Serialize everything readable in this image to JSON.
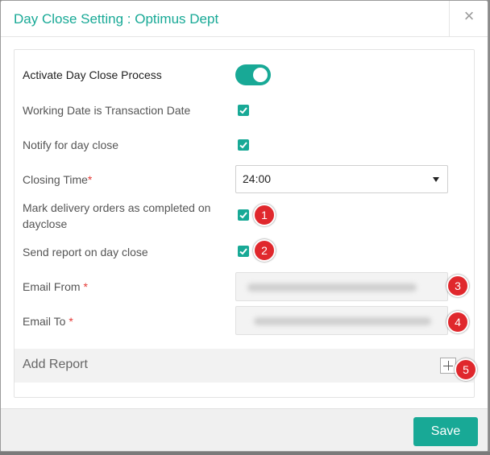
{
  "modal": {
    "title": "Day Close Setting : Optimus Dept",
    "close_glyph": "×"
  },
  "settings": {
    "activate_label": "Activate Day Close Process",
    "activate_on": true,
    "working_date_label": "Working Date is Transaction Date",
    "working_date_checked": true,
    "notify_label": "Notify for day close",
    "notify_checked": true,
    "closing_time_label": "Closing Time",
    "closing_time_value": "24:00",
    "mark_delivery_label_line1": "Mark delivery orders as completed on",
    "mark_delivery_label_line2": "dayclose",
    "mark_delivery_checked": true,
    "send_report_label": "Send report on day close",
    "send_report_checked": true,
    "email_from_label": "Email From",
    "email_to_label": "Email To",
    "required_mark": "*"
  },
  "badges": [
    "1",
    "2",
    "3",
    "4",
    "5"
  ],
  "add_report": {
    "label": "Add Report"
  },
  "footer": {
    "save_label": "Save"
  },
  "colors": {
    "accent": "#18a996",
    "badge": "#e0282d"
  },
  "icons": {
    "close": "close-icon",
    "check": "checkmark-icon",
    "dropdown": "caret-down-icon",
    "add": "plus-icon"
  }
}
